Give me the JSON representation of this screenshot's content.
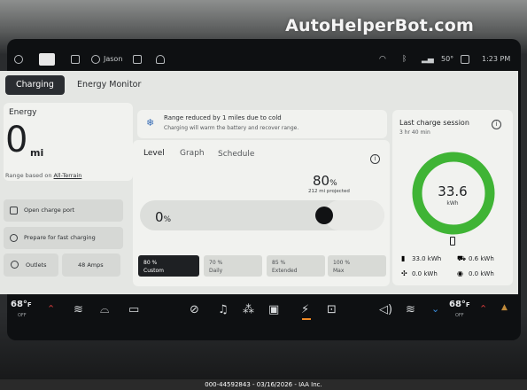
{
  "watermark": "AutoHelperBot.com",
  "status": {
    "profile_name": "Jason",
    "temperature": "50°",
    "time": "1:23 PM"
  },
  "tabs": [
    {
      "label": "Charging",
      "active": true
    },
    {
      "label": "Energy Monitor",
      "active": false
    }
  ],
  "energy": {
    "title": "Energy",
    "value": "0",
    "unit": "mi",
    "range_based_on": "Range based on",
    "range_mode": "All-Terrain",
    "actions": [
      {
        "label": "Open charge port",
        "icon": "charge-port-icon"
      },
      {
        "label": "Prepare for fast charging",
        "icon": "fast-charge-icon"
      }
    ],
    "outlets_label": "Outlets",
    "amps": "48 Amps"
  },
  "notice": {
    "title": "Range reduced by 1 miles due to cold",
    "subtitle": "Charging will warm the battery and recover range."
  },
  "level": {
    "tabs": [
      "Level",
      "Graph",
      "Schedule"
    ],
    "current_percent": "0",
    "target_percent": "80",
    "percent_sign": "%",
    "projected": "212 mi projected",
    "target_fraction": 0.8,
    "presets": [
      {
        "value": "80 %",
        "label": "Custom",
        "active": true
      },
      {
        "value": "70 %",
        "label": "Daily",
        "active": false
      },
      {
        "value": "85 %",
        "label": "Extended",
        "active": false
      },
      {
        "value": "100 %",
        "label": "Max",
        "active": false
      }
    ]
  },
  "last_session": {
    "title": "Last charge session",
    "duration": "3 hr 40 min",
    "total": "33.6",
    "total_unit": "kWh",
    "ring_color": "#3fb435",
    "stats": [
      {
        "icon": "battery-icon",
        "value": "33.0 kWh"
      },
      {
        "icon": "car-icon",
        "value": "0.6 kWh"
      },
      {
        "icon": "fan-icon",
        "value": "0.0 kWh"
      },
      {
        "icon": "drive-icon",
        "value": "0.0 kWh"
      }
    ]
  },
  "climate": {
    "left_temp": "68°",
    "left_unit": "F",
    "left_state": "OFF",
    "right_temp": "68°",
    "right_unit": "F",
    "right_state": "OFF"
  },
  "footer": "000-44592843 - 03/16/2026 - IAA Inc."
}
